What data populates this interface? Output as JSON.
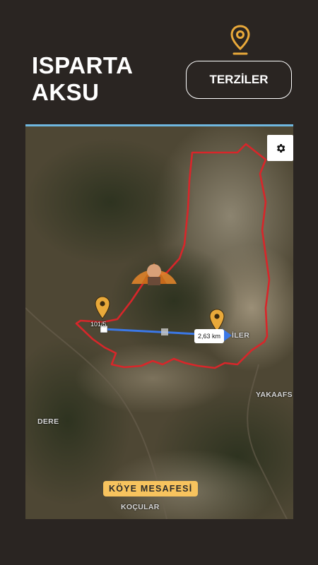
{
  "header": {
    "province": "ISPARTA",
    "district": "AKSU",
    "village_button": "TERZİLER"
  },
  "icons": {
    "top_pin": "map-pin-icon",
    "settings": "gear-icon",
    "markers": "map-marker-icon"
  },
  "colors": {
    "background": "#2a2522",
    "pin_gold": "#e9a93a",
    "boundary_red": "#d8262a",
    "route_blue": "#3b78e7",
    "badge_yellow": "#f7c35e"
  },
  "map": {
    "start_label": "101/5",
    "distance_label": "2,63 km",
    "places": {
      "village_label": "İLER",
      "yakaafs": "YAKAAFS",
      "dere": "DERE",
      "kocular": "KOÇULAR"
    },
    "badge": "KÖYE MESAFESİ"
  }
}
